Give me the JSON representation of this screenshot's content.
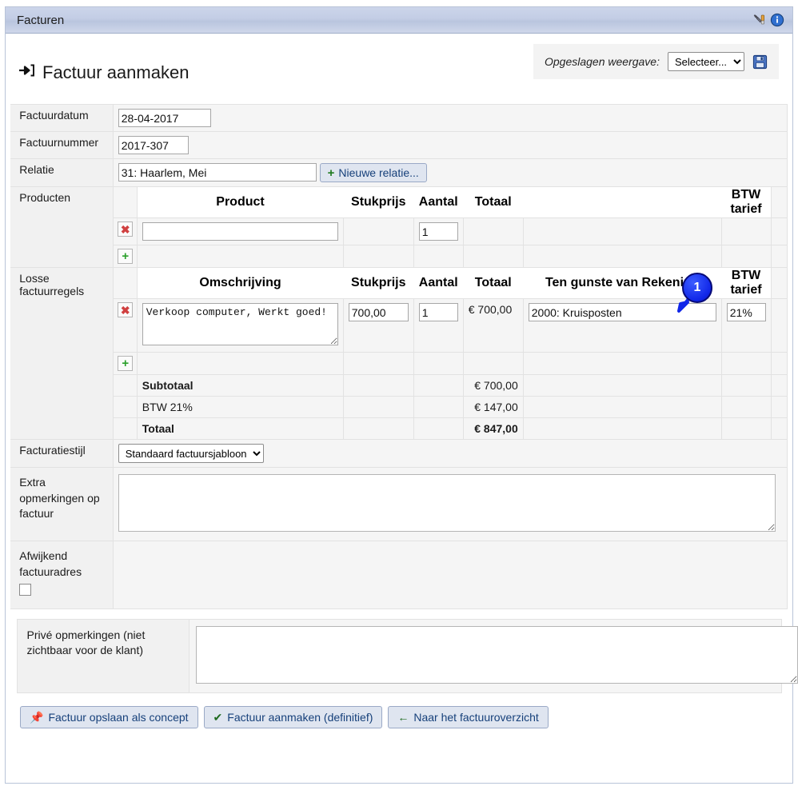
{
  "window": {
    "title": "Facturen",
    "icons": [
      "tools-icon",
      "info-icon"
    ]
  },
  "header": {
    "page_title": "Factuur aanmaken",
    "title_icon": "sign-in-arrow-icon",
    "saved_view_label": "Opgeslagen weergave:",
    "saved_view_selected": "Selecteer...",
    "saved_view_options": [
      "Selecteer..."
    ],
    "save_view_icon": "floppy-save-icon"
  },
  "form": {
    "invoice_date_label": "Factuurdatum",
    "invoice_date_value": "28-04-2017",
    "invoice_number_label": "Factuurnummer",
    "invoice_number_value": "2017-307",
    "relation_label": "Relatie",
    "relation_value": "31: Haarlem, Mei",
    "new_relation_button": "Nieuwe relatie...",
    "new_relation_icon": "plus-icon"
  },
  "products": {
    "section_label": "Producten",
    "columns": [
      "Product",
      "Stukprijs",
      "Aantal",
      "Totaal",
      "",
      "BTW tarief"
    ],
    "rows": [
      {
        "delete_icon": "delete-x-icon",
        "product": "",
        "price": "",
        "qty": "1",
        "total": "",
        "account": "",
        "btw": ""
      }
    ],
    "add_icon": "add-plus-icon"
  },
  "loose_lines": {
    "section_label": "Losse factuurregels",
    "columns": [
      "Omschrijving",
      "Stukprijs",
      "Aantal",
      "Totaal",
      "Ten gunste van Rekening",
      "BTW tarief"
    ],
    "rows": [
      {
        "delete_icon": "delete-x-icon",
        "description": "Verkoop computer, Werkt goed!",
        "price": "700,00",
        "qty": "1",
        "total": "€ 700,00",
        "account": "2000: Kruisposten",
        "btw": "21%"
      }
    ],
    "add_icon": "add-plus-icon"
  },
  "totals": [
    {
      "label": "Subtotaal",
      "value": "€ 700,00",
      "bold": true
    },
    {
      "label": "BTW 21%",
      "value": "€ 147,00",
      "bold": false
    },
    {
      "label": "Totaal",
      "value": "€ 847,00",
      "bold": true
    }
  ],
  "totals_rows": {
    "subtotal_label": "Subtotaal",
    "subtotal_value": "€ 700,00",
    "vat_label": "BTW 21%",
    "vat_value": "€ 147,00",
    "total_label": "Totaal",
    "total_value": "€ 847,00"
  },
  "style_row": {
    "label": "Facturatiestijl",
    "selected": "Standaard factuursjabloon",
    "options": [
      "Standaard factuursjabloon"
    ]
  },
  "extra_notes": {
    "label": "Extra opmerkingen op factuur",
    "value": "",
    "placeholder": ""
  },
  "alt_address": {
    "label": "Afwijkend factuuradres",
    "checked": false
  },
  "private_notes": {
    "label": "Privé opmerkingen (niet zichtbaar voor de klant)",
    "value": "",
    "placeholder": ""
  },
  "footer": {
    "save_draft": "Factuur opslaan als concept",
    "save_draft_icon": "pin-icon",
    "create_final": "Factuur aanmaken (definitief)",
    "create_final_icon": "check-icon",
    "back_overview": "Naar het factuuroverzicht",
    "back_overview_icon": "arrow-left-icon"
  },
  "callout": {
    "number": "1",
    "color": "#1026e8"
  }
}
